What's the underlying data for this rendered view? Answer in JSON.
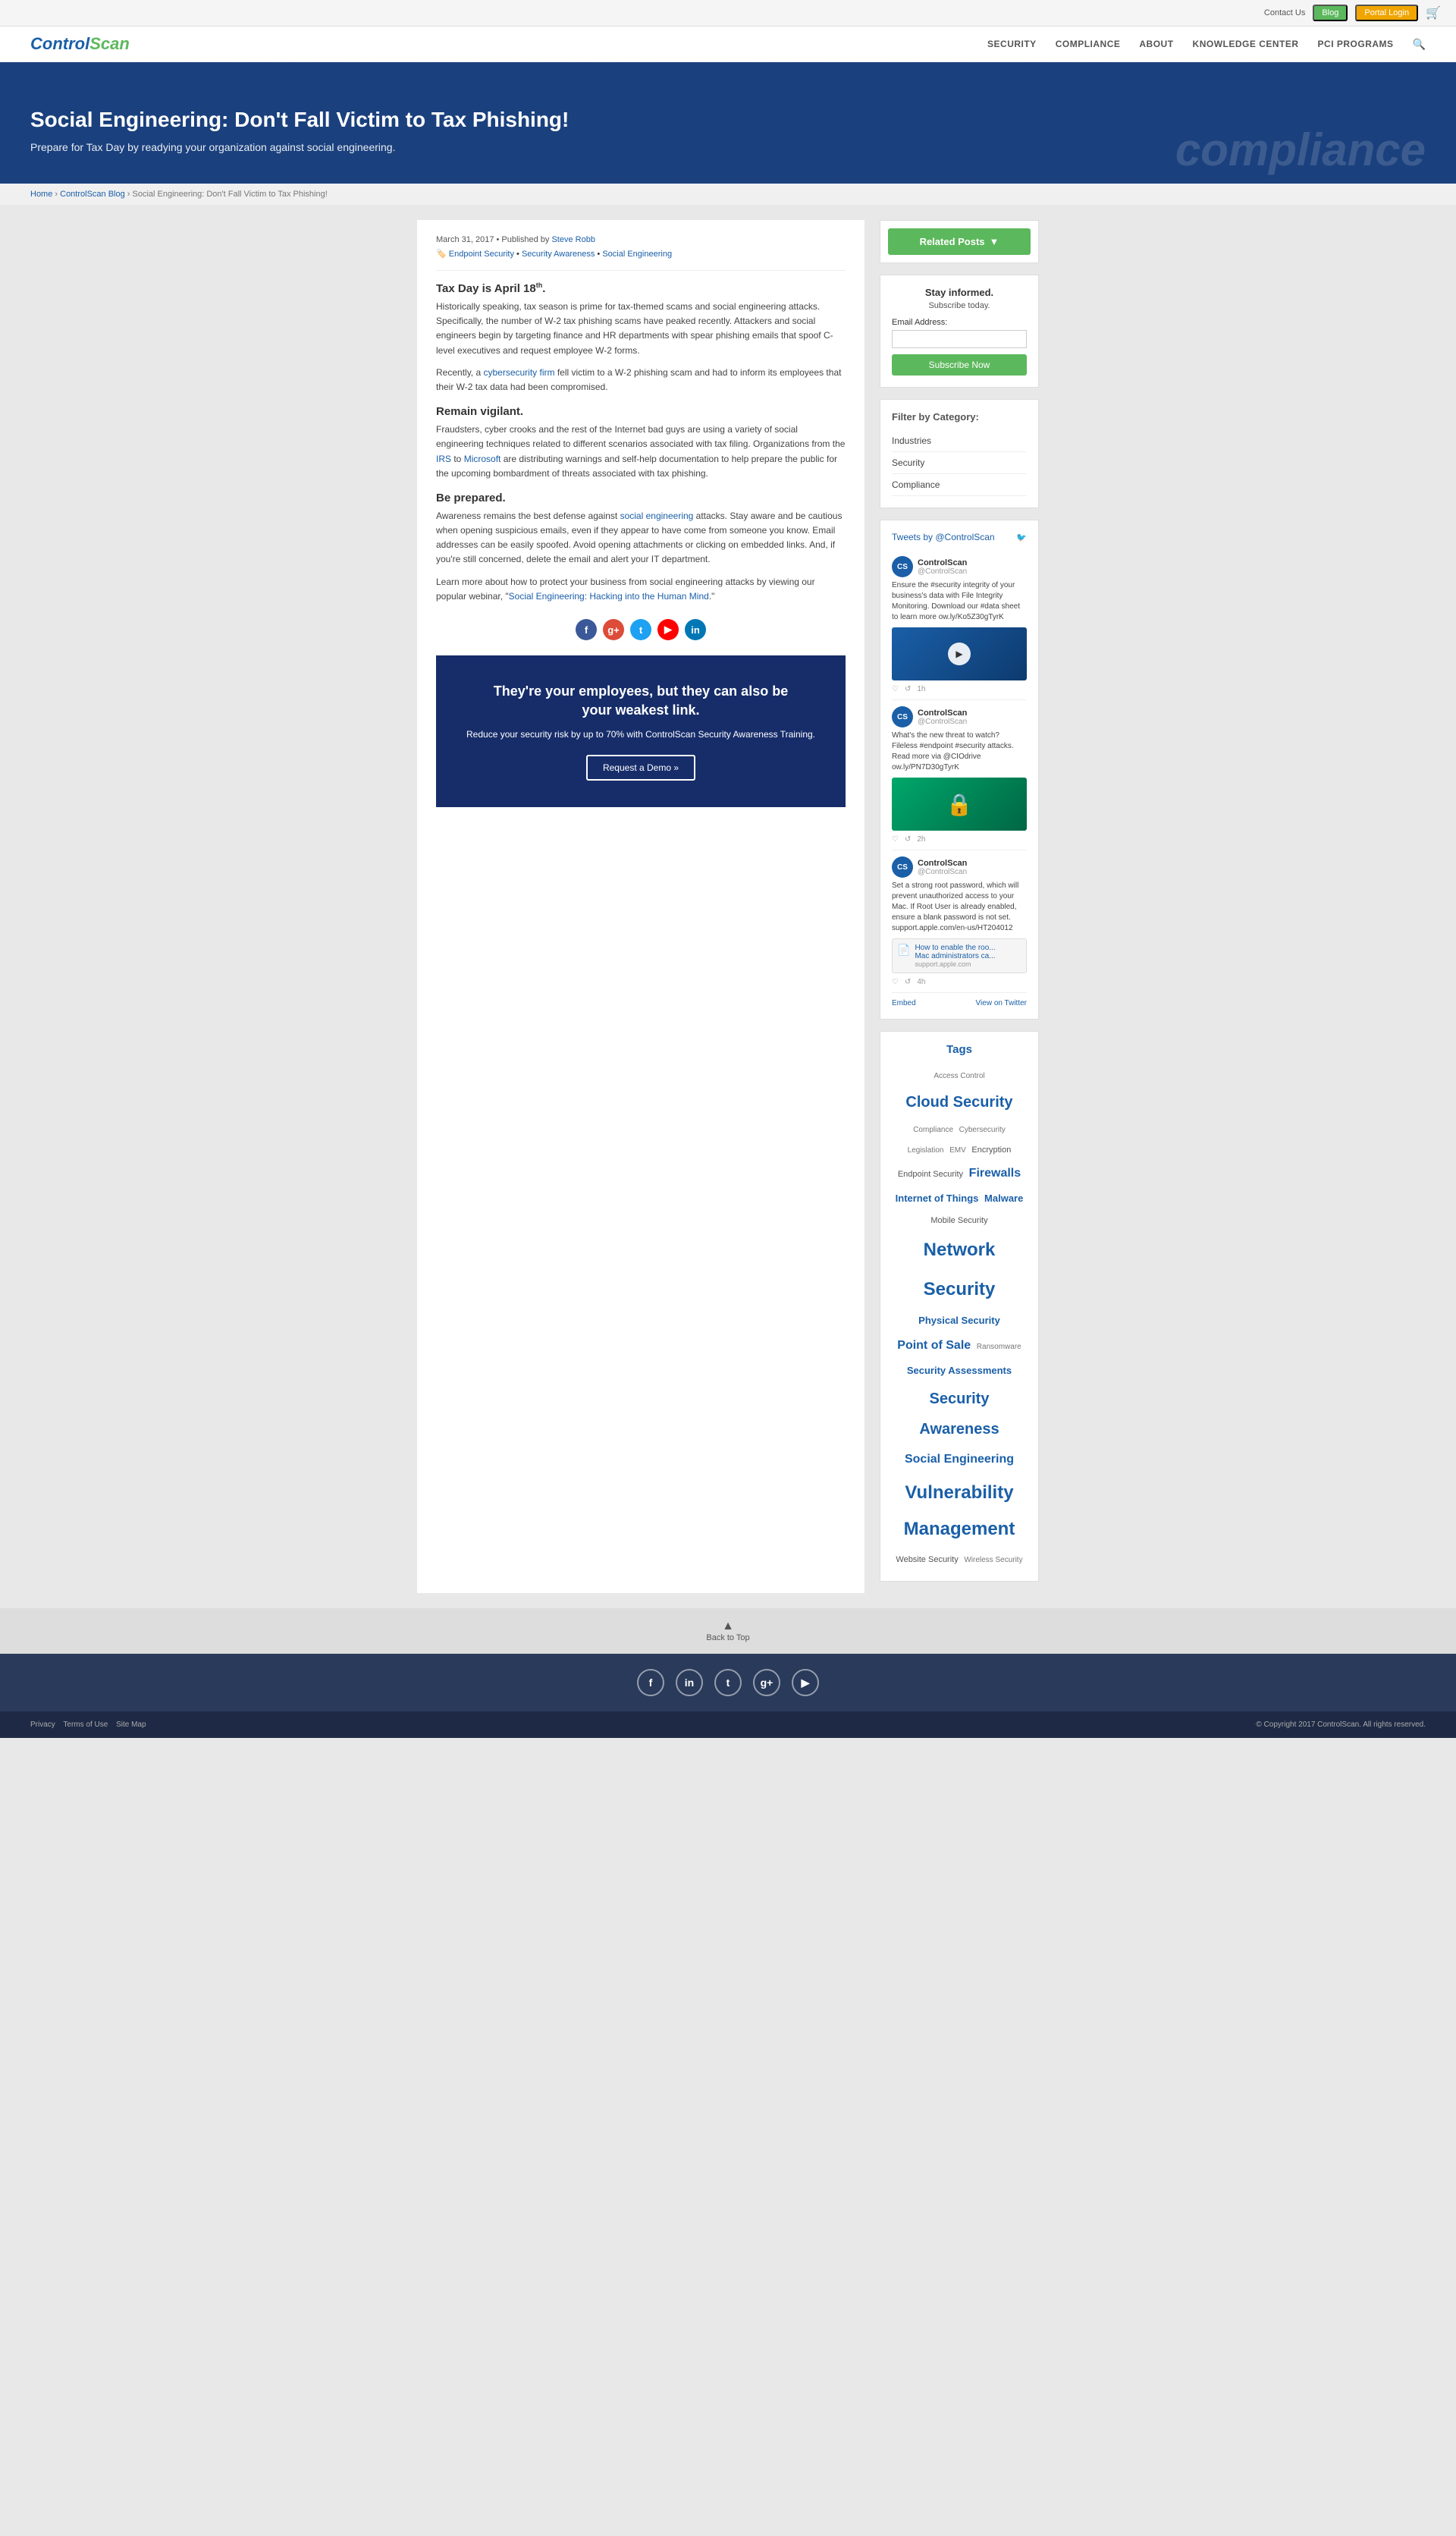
{
  "topbar": {
    "contact": "Contact Us",
    "blog_label": "Blog",
    "portal_label": "Portal Login"
  },
  "nav": {
    "logo": "ControlScan",
    "links": [
      "SECURITY",
      "COMPLIANCE",
      "ABOUT",
      "KNOWLEDGE CENTER",
      "PCI PROGRAMS"
    ]
  },
  "hero": {
    "title": "Social Engineering: Don't Fall Victim to Tax Phishing!",
    "subtitle": "Prepare for Tax Day by readying your organization against social engineering.",
    "bg_word": "compliance"
  },
  "breadcrumb": {
    "home": "Home",
    "blog": "ControlScan Blog",
    "current": "Social Engineering: Don't Fall Victim to Tax Phishing!"
  },
  "article": {
    "date": "March 31, 2017",
    "published_by": "Published by",
    "author": "Steve Robb",
    "tag1": "Endpoint Security",
    "tag2": "Security Awareness",
    "tag3": "Social Engineering",
    "h_intro": "Tax Day is April 18",
    "h_intro_sup": "th",
    "p1": "Historically speaking, tax season is prime for tax-themed scams and social engineering attacks. Specifically, the number of W-2 tax phishing scams have peaked recently. Attackers and social engineers begin by targeting finance and HR departments with spear phishing emails that spoof C-level executives and request employee W-2 forms.",
    "p2": "Recently, a cybersecurity firm fell victim to a W-2 phishing scam and had to inform its employees that their W-2 tax data had been compromised.",
    "h_vigilant": "Remain vigilant.",
    "p3": "Fraudsters, cyber crooks and the rest of the Internet bad guys are using a variety of social engineering techniques related to different scenarios associated with tax filing. Organizations from the IRS to Microsoft are distributing warnings and self-help documentation to help prepare the public for the upcoming bombardment of threats associated with tax phishing.",
    "h_prepared": "Be prepared.",
    "p4": "Awareness remains the best defense against social engineering attacks. Stay aware and be cautious when opening suspicious emails, even if they appear to have come from someone you know. Email addresses can be easily spoofed. Avoid opening attachments or clicking on embedded links. And, if you're still concerned, delete the email and alert your IT department.",
    "p5": "Learn more about how to protect your business from social engineering attacks by viewing our popular webinar, \"Social Engineering: Hacking into the Human Mind.\"",
    "webinar_link": "Social Engineering: Hacking into the Human Mind"
  },
  "cta": {
    "heading1": "They're your employees, but they can also be",
    "heading2": "your weakest link.",
    "body": "Reduce your security risk by up to 70% with ControlScan Security Awareness Training.",
    "button": "Request a Demo »"
  },
  "sidebar": {
    "related_posts": "Related Posts",
    "subscribe_heading": "Stay informed.",
    "subscribe_subheading": "Subscribe today.",
    "email_label": "Email Address:",
    "email_placeholder": "",
    "subscribe_btn": "Subscribe Now",
    "filter_heading": "Filter by Category:",
    "filter_items": [
      "Industries",
      "Security",
      "Compliance"
    ],
    "tweets_title": "Tweets",
    "tweets_by": "by @ControlScan",
    "tweet1_name": "ControlScan",
    "tweet1_handle": "@ControlScan",
    "tweet1_text": "Ensure the #security integrity of your business's data with File Integrity Monitoring. Download our #data sheet to learn more ow.ly/Ko5Z30gTyrK",
    "tweet2_name": "ControlScan",
    "tweet2_handle": "@ControlScan",
    "tweet2_text": "What's the new threat to watch? Fileless #endpoint #security attacks. Read more via @CIOdrive ow.ly/PN7D30gTyrK",
    "tweet3_name": "ControlScan",
    "tweet3_handle": "@ControlScan",
    "tweet3_text": "Set a strong root password, which will prevent unauthorized access to your Mac. If Root User is already enabled, ensure a blank password is not set. support.apple.com/en-us/HT204012",
    "tweet3_link_title": "How to enable the roo...",
    "tweet3_link_desc": "Mac administrators ca...",
    "tweet3_link_domain": "support.apple.com",
    "embed_label": "Embed",
    "view_on_twitter": "View on Twitter",
    "tags_heading": "Tags",
    "tags": [
      {
        "text": "Access Control",
        "size": "xs"
      },
      {
        "text": "Cloud Security",
        "size": "xl"
      },
      {
        "text": "Compliance",
        "size": "sm"
      },
      {
        "text": "Cybersecurity",
        "size": "sm"
      },
      {
        "text": "Legislation",
        "size": "xs"
      },
      {
        "text": "EMV",
        "size": "xs"
      },
      {
        "text": "Encryption",
        "size": "sm"
      },
      {
        "text": "Endpoint Security",
        "size": "sm"
      },
      {
        "text": "Firewalls",
        "size": "lg"
      },
      {
        "text": "Internet of Things",
        "size": "md"
      },
      {
        "text": "Malware",
        "size": "md"
      },
      {
        "text": "Mobile Security",
        "size": "sm"
      },
      {
        "text": "Network",
        "size": "xxl"
      },
      {
        "text": "Security",
        "size": "xxl"
      },
      {
        "text": "Physical Security",
        "size": "md"
      },
      {
        "text": "Point of Sale",
        "size": "lg"
      },
      {
        "text": "Ransomware",
        "size": "xs"
      },
      {
        "text": "Security Assessments",
        "size": "md"
      },
      {
        "text": "Security Awareness",
        "size": "xl"
      },
      {
        "text": "Social Engineering",
        "size": "lg"
      },
      {
        "text": "Vulnerability Management",
        "size": "xxl"
      },
      {
        "text": "Website Security",
        "size": "sm"
      },
      {
        "text": "Wireless Security",
        "size": "xs"
      }
    ]
  },
  "back_to_top": "Back to Top",
  "footer": {
    "social_icons": [
      "f",
      "in",
      "t",
      "g+",
      "▶"
    ],
    "links": [
      "Privacy",
      "Terms of Use",
      "Site Map"
    ],
    "copyright": "© Copyright 2017 ControlScan. All rights reserved."
  }
}
